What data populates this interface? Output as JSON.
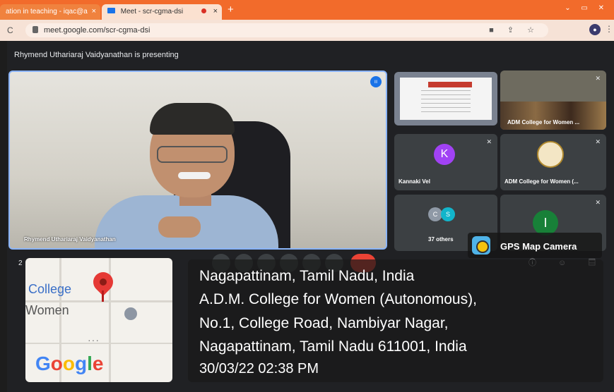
{
  "browser": {
    "tabs": [
      {
        "label": "ation in teaching - iqac@a"
      },
      {
        "label": "Meet - scr-cgma-dsi"
      }
    ],
    "new_tab": "+",
    "url": "meet.google.com/scr-cgma-dsi"
  },
  "meet": {
    "presenting_banner": "Rhymend Uthariaraj Vaidyanathan is presenting",
    "main_name": "Rhymend Uthariaraj Vaidyanathan",
    "tiles": {
      "tile2_label": "ADM College for Women ...",
      "tile3_initial": "K",
      "tile3_label": "Kannaki Vel",
      "tile4_label": "ADM College for Women (...",
      "others_label": "37 others",
      "others_initials": [
        "C",
        "S"
      ],
      "tile6_initial": "I"
    },
    "time_partial": "2"
  },
  "overlay": {
    "gps_app": "GPS Map Camera",
    "map_place_1": "College",
    "map_place_2": "Women",
    "map_brand": "Google",
    "address_lines": [
      "Nagapattinam, Tamil Nadu, India",
      "A.D.M. College for Women (Autonomous),",
      "No.1, College Road, Nambiyar Nagar,",
      "Nagapattinam, Tamil Nadu 611001, India",
      "30/03/22 02:38 PM"
    ]
  },
  "colors": {
    "tab_bar": "#f26b2b",
    "meet_bg": "#202124",
    "active_border": "#8ab4f8",
    "avatar_k": "#a142f4",
    "avatar_i": "#188038",
    "pin": "#e53935"
  }
}
